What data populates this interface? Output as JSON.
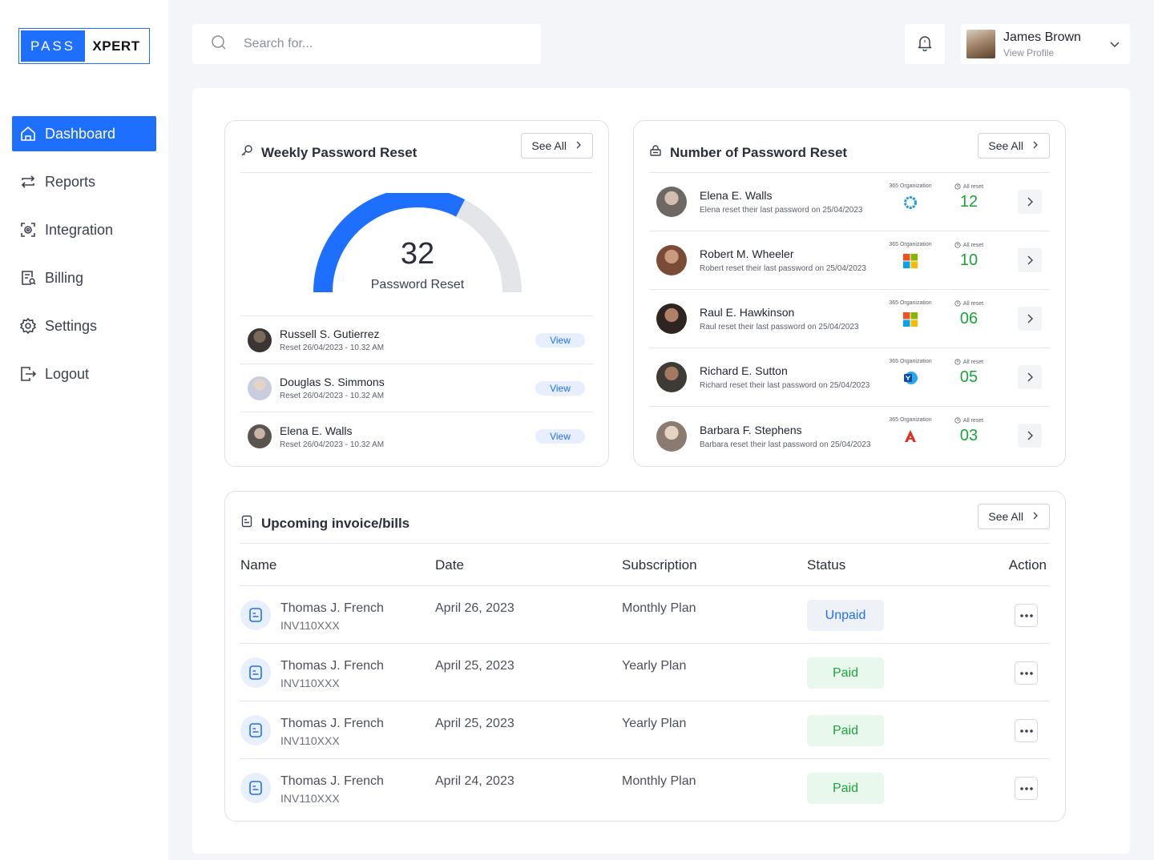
{
  "brand": {
    "left": "PASS",
    "right": "XPERT"
  },
  "colors": {
    "accent": "#1f6fff",
    "success": "#1aa53a"
  },
  "sidebar": {
    "items": [
      {
        "label": "Dashboard",
        "icon": "home-icon",
        "active": true
      },
      {
        "label": "Reports",
        "icon": "repeat-icon"
      },
      {
        "label": "Integration",
        "icon": "integration-icon"
      },
      {
        "label": "Billing",
        "icon": "billing-icon"
      },
      {
        "label": "Settings",
        "icon": "gear-icon"
      },
      {
        "label": "Logout",
        "icon": "logout-icon"
      }
    ]
  },
  "search": {
    "placeholder": "Search for..."
  },
  "profile": {
    "name": "James Brown",
    "sub": "View Profile"
  },
  "weekly": {
    "title": "Weekly Password Reset",
    "see_all": "See All",
    "count": "32",
    "count_label": "Password Reset",
    "gauge_fraction": 0.65,
    "rows": [
      {
        "name": "Russell S. Gutierrez",
        "sub": "Reset 26/04/2023 - 10.32 AM",
        "action": "View"
      },
      {
        "name": "Douglas S. Simmons",
        "sub": "Reset 26/04/2023 - 10.32 AM",
        "action": "View"
      },
      {
        "name": "Elena E. Walls",
        "sub": "Reset 26/04/2023 - 10.32 AM",
        "action": "View"
      }
    ]
  },
  "resets": {
    "title": "Number of Password Reset",
    "see_all": "See All",
    "org_label": "365 Organization",
    "count_label": "All reset",
    "rows": [
      {
        "name": "Elena E. Walls",
        "sub": "Elena reset their last password on 25/04/2023",
        "org_icon": "ring-icon",
        "count": "12"
      },
      {
        "name": "Robert M. Wheeler",
        "sub": "Robert reset their last password on 25/04/2023",
        "org_icon": "microsoft-icon",
        "count": "10"
      },
      {
        "name": "Raul E. Hawkinson",
        "sub": "Raul reset their last password on 25/04/2023",
        "org_icon": "microsoft-icon",
        "count": "06"
      },
      {
        "name": "Richard E. Sutton",
        "sub": "Richard reset their last password on 25/04/2023",
        "org_icon": "yammer-icon",
        "count": "05"
      },
      {
        "name": "Barbara F. Stephens",
        "sub": "Barbara reset their last password on 25/04/2023",
        "org_icon": "acrobat-icon",
        "count": "03"
      }
    ]
  },
  "invoices": {
    "title": "Upcoming invoice/bills",
    "see_all": "See All",
    "columns": [
      "Name",
      "Date",
      "Subscription",
      "Status",
      "Action"
    ],
    "rows": [
      {
        "name": "Thomas J. French",
        "id": "INV110XXX",
        "date": "April 26, 2023",
        "plan": "Monthly Plan",
        "status": "Unpaid"
      },
      {
        "name": "Thomas J. French",
        "id": "INV110XXX",
        "date": "April 25, 2023",
        "plan": "Yearly Plan",
        "status": "Paid"
      },
      {
        "name": "Thomas J. French",
        "id": "INV110XXX",
        "date": "April 25, 2023",
        "plan": "Yearly Plan",
        "status": "Paid"
      },
      {
        "name": "Thomas J. French",
        "id": "INV110XXX",
        "date": "April 24, 2023",
        "plan": "Monthly Plan",
        "status": "Paid"
      }
    ]
  }
}
